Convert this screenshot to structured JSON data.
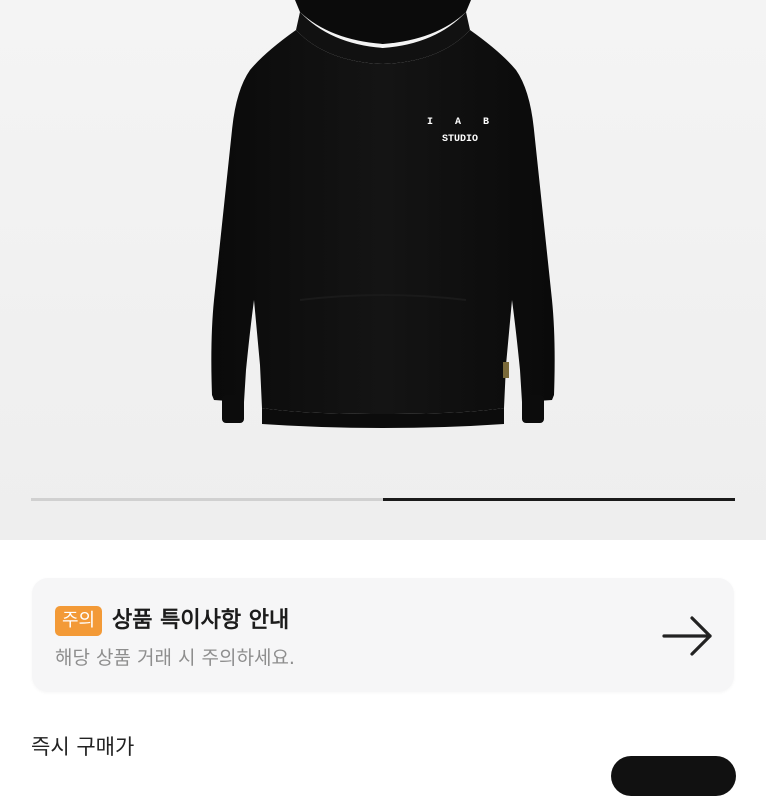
{
  "product": {
    "print_line1": "I A B",
    "print_line2": "STUDIO",
    "garment_color": "#0d0d0d"
  },
  "gallery": {
    "progress_fraction": 0.5,
    "progress_start_fraction": 0.5
  },
  "notice": {
    "badge": "주의",
    "title": "상품 특이사항 안내",
    "description": "해당 상품 거래 시 주의하세요.",
    "arrow_icon": "arrow-right-icon",
    "badge_color": "#f39a37"
  },
  "purchase": {
    "label": "즉시 구매가"
  }
}
